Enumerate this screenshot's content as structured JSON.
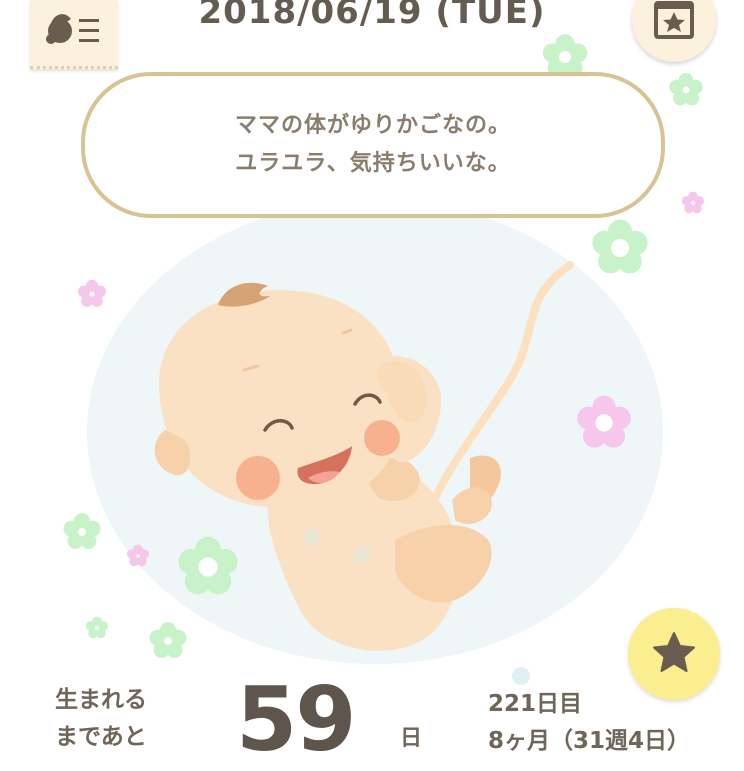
{
  "header": {
    "date": "2018/06/19 (TUE)",
    "menu_icon": "baby-menu-icon",
    "calendar_icon": "calendar-star-icon"
  },
  "speech": {
    "line1": "ママの体がゆりかごなの。",
    "line2": "ユラユラ、気持ちいいな。"
  },
  "countdown": {
    "label_line1": "生まれる",
    "label_line2": "まであと",
    "days": "59",
    "unit": "日"
  },
  "progress": {
    "day_count": "221日目",
    "month_week": "8ヶ月（31週4日）"
  },
  "fab": {
    "icon": "star-icon"
  },
  "colors": {
    "text": "#655c51",
    "bubble_border": "#d9c294",
    "button_bg": "#fbf1dc",
    "star_button_bg": "#fbee8f",
    "womb_bg": "#eef6f8",
    "flower_green": "#c8f3c8",
    "flower_pink": "#f6c6ec"
  }
}
